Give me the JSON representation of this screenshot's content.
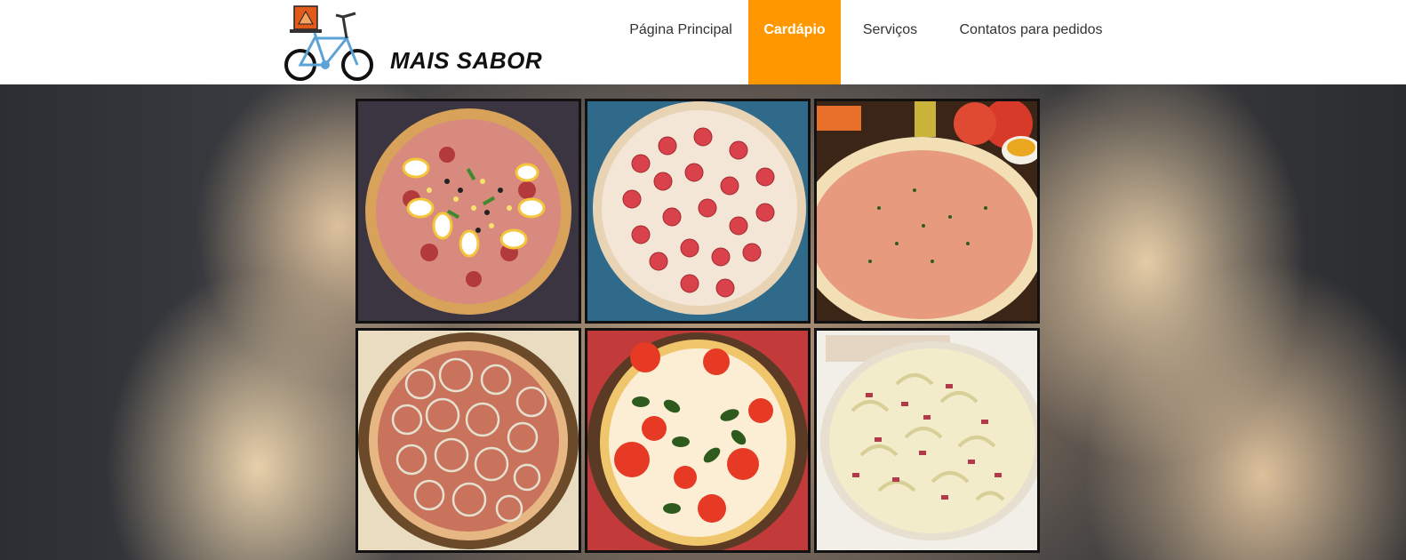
{
  "brand": {
    "name": "MAIS SABOR"
  },
  "nav": {
    "items": [
      {
        "label": "Página Principal",
        "active": false
      },
      {
        "label": "Cardápio",
        "active": true
      },
      {
        "label": "Serviços",
        "active": false
      },
      {
        "label": "Contatos para pedidos",
        "active": false
      }
    ],
    "active_color": "#FF9800"
  },
  "menu_images": [
    {
      "name": "pizza-portuguesa"
    },
    {
      "name": "pizza-calabresa-mussarela"
    },
    {
      "name": "pizza-atum"
    },
    {
      "name": "pizza-calabresa-cebola"
    },
    {
      "name": "pizza-marguerita"
    },
    {
      "name": "pizza-bacon-catupiry"
    }
  ]
}
